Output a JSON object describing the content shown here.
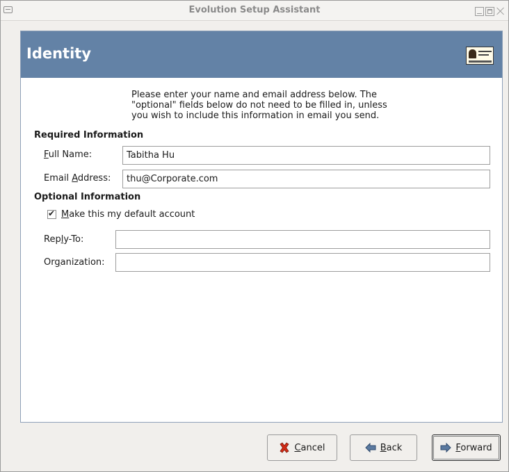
{
  "window": {
    "title": "Evolution Setup Assistant"
  },
  "header": {
    "title": "Identity"
  },
  "intro_text": "Please enter your name and email address below. The\n\"optional\" fields below do not need to be filled in, unless\nyou wish to include this information in email you send.",
  "required": {
    "title": "Required Information",
    "full_name": {
      "label_prefix": "",
      "label_mnemonic": "F",
      "label_rest": "ull Name:",
      "value": "Tabitha Hu"
    },
    "email": {
      "label_prefix": "Email ",
      "label_mnemonic": "A",
      "label_rest": "ddress:",
      "value": "thu@Corporate.com"
    }
  },
  "optional": {
    "title": "Optional Information",
    "default_account": {
      "label_mnemonic": "M",
      "label_rest": "ake this my default account",
      "checked": true
    },
    "reply_to": {
      "label_prefix": "Rep",
      "label_mnemonic": "l",
      "label_rest": "y-To:",
      "value": ""
    },
    "organization": {
      "label_prefix": "Or",
      "label_mnemonic": "g",
      "label_rest": "anization:",
      "value": ""
    }
  },
  "buttons": {
    "cancel": {
      "mnemonic": "C",
      "rest": "ancel"
    },
    "back": {
      "mnemonic": "B",
      "rest": "ack"
    },
    "forward": {
      "mnemonic": "F",
      "rest": "orward"
    }
  },
  "colors": {
    "header_bg": "#6382a6",
    "cancel_icon": "#d12a16"
  },
  "icons": {
    "header_badge": "id-card-icon",
    "cancel": "cancel-x-icon",
    "back": "back-arrow-icon",
    "forward": "forward-arrow-icon"
  }
}
